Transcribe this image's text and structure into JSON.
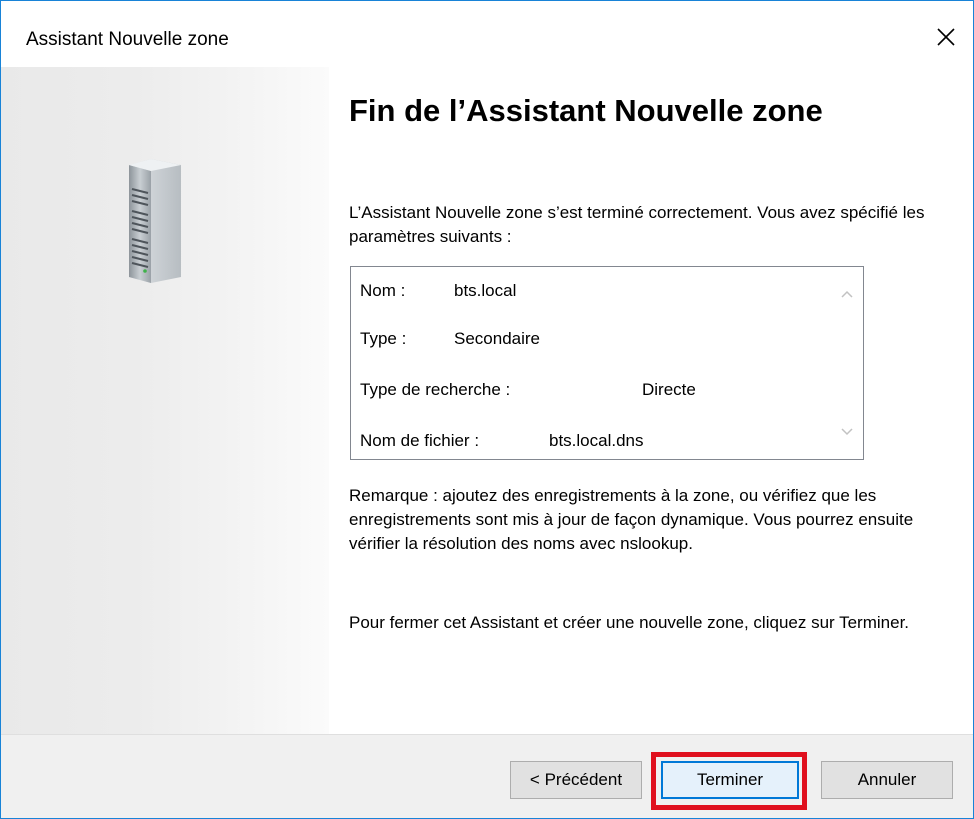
{
  "window": {
    "title": "Assistant Nouvelle zone"
  },
  "icons": {
    "close": "close-icon",
    "server": "server-icon",
    "scroll_up": "chevron-up-icon",
    "scroll_down": "chevron-down-icon"
  },
  "colors": {
    "window_border": "#1883d7",
    "default_button_border": "#0078d7",
    "highlight": "#e0101e",
    "footer_bg": "#f0f0f0"
  },
  "main": {
    "heading": "Fin de l’Assistant Nouvelle zone",
    "intro": "L’Assistant Nouvelle zone s’est terminé correctement. Vous avez spécifié les paramètres suivants :",
    "summary": [
      {
        "label": "Nom :",
        "value": "bts.local"
      },
      {
        "label": "Type :",
        "value": "Secondaire"
      },
      {
        "label": "Type de recherche :",
        "value": "Directe"
      },
      {
        "label": "Nom de fichier :",
        "value": "bts.local.dns"
      }
    ],
    "note": "Remarque : ajoutez des enregistrements à la zone, ou vérifiez que les enregistrements sont mis à jour de façon dynamique. Vous pourrez ensuite vérifier la résolution des noms avec nslookup.",
    "closing": "Pour fermer cet Assistant et créer une nouvelle zone, cliquez sur Terminer."
  },
  "footer": {
    "prev_label": "< Précédent",
    "finish_label": "Terminer",
    "cancel_label": "Annuler"
  }
}
